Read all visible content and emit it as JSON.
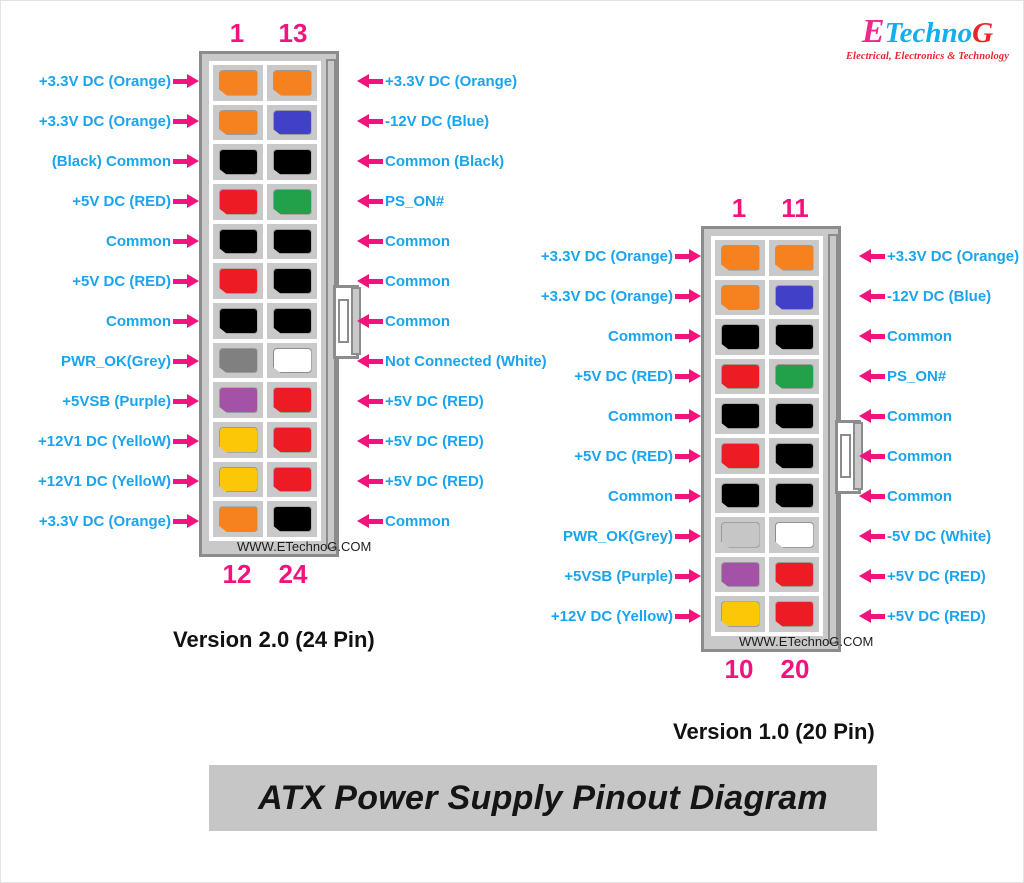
{
  "logo": {
    "letter_e": "E",
    "word_techno": "Techno",
    "letter_g": "G",
    "tagline": "Electrical, Electronics & Technology"
  },
  "banner": {
    "title": "ATX Power Supply Pinout Diagram"
  },
  "colors": {
    "label_blue": "#1ba4ee",
    "accent_pink": "#f2137e",
    "shell_grey": "#c9c9c9",
    "shell_border": "#8c8c8c",
    "banner_bg": "#c6c6c6",
    "orange": "#f5821f",
    "blue": "#4040c8",
    "black": "#000000",
    "red": "#ed1c24",
    "green": "#22a14a",
    "grey": "#808080",
    "white": "#ffffff",
    "purple": "#a452a8",
    "yellow": "#fbc707",
    "lightgrey": "#c6c6c6"
  },
  "connector24": {
    "caption": "Version 2.0 (24 Pin)",
    "watermark": "WWW.ETechnoG.COM",
    "top_left_num": "1",
    "top_right_num": "13",
    "bottom_left_num": "12",
    "bottom_right_num": "24",
    "rows": [
      {
        "left_label": "+3.3V DC (Orange)",
        "left_color": "#f5821f",
        "right_label": "+3.3V DC (Orange)",
        "right_color": "#f5821f"
      },
      {
        "left_label": "+3.3V DC (Orange)",
        "left_color": "#f5821f",
        "right_label": "-12V DC (Blue)",
        "right_color": "#4040c8"
      },
      {
        "left_label": "(Black) Common",
        "left_color": "#000000",
        "right_label": "Common (Black)",
        "right_color": "#000000"
      },
      {
        "left_label": "+5V DC (RED)",
        "left_color": "#ed1c24",
        "right_label": "PS_ON#",
        "right_color": "#22a14a"
      },
      {
        "left_label": "Common",
        "left_color": "#000000",
        "right_label": "Common",
        "right_color": "#000000"
      },
      {
        "left_label": "+5V DC (RED)",
        "left_color": "#ed1c24",
        "right_label": "Common",
        "right_color": "#000000"
      },
      {
        "left_label": "Common",
        "left_color": "#000000",
        "right_label": "Common",
        "right_color": "#000000"
      },
      {
        "left_label": "PWR_OK(Grey)",
        "left_color": "#808080",
        "right_label": "Not Connected (White)",
        "right_color": "#ffffff"
      },
      {
        "left_label": "+5VSB (Purple)",
        "left_color": "#a452a8",
        "right_label": "+5V DC (RED)",
        "right_color": "#ed1c24"
      },
      {
        "left_label": "+12V1 DC (YelloW)",
        "left_color": "#fbc707",
        "right_label": "+5V DC (RED)",
        "right_color": "#ed1c24"
      },
      {
        "left_label": "+12V1 DC (YelloW)",
        "left_color": "#fbc707",
        "right_label": "+5V DC (RED)",
        "right_color": "#ed1c24"
      },
      {
        "left_label": "+3.3V DC (Orange)",
        "left_color": "#f5821f",
        "right_label": "Common",
        "right_color": "#000000"
      }
    ]
  },
  "connector20": {
    "caption": "Version 1.0  (20 Pin)",
    "watermark": "WWW.ETechnoG.COM",
    "top_left_num": "1",
    "top_right_num": "11",
    "bottom_left_num": "10",
    "bottom_right_num": "20",
    "rows": [
      {
        "left_label": "+3.3V DC (Orange)",
        "left_color": "#f5821f",
        "right_label": "+3.3V DC (Orange)",
        "right_color": "#f5821f"
      },
      {
        "left_label": "+3.3V DC (Orange)",
        "left_color": "#f5821f",
        "right_label": "-12V DC (Blue)",
        "right_color": "#4040c8"
      },
      {
        "left_label": "Common",
        "left_color": "#000000",
        "right_label": "Common",
        "right_color": "#000000"
      },
      {
        "left_label": "+5V DC (RED)",
        "left_color": "#ed1c24",
        "right_label": "PS_ON#",
        "right_color": "#22a14a"
      },
      {
        "left_label": "Common",
        "left_color": "#000000",
        "right_label": "Common",
        "right_color": "#000000"
      },
      {
        "left_label": "+5V DC (RED)",
        "left_color": "#ed1c24",
        "right_label": "Common",
        "right_color": "#000000"
      },
      {
        "left_label": "Common",
        "left_color": "#000000",
        "right_label": "Common",
        "right_color": "#000000"
      },
      {
        "left_label": "PWR_OK(Grey)",
        "left_color": "#c6c6c6",
        "right_label": "-5V DC (White)",
        "right_color": "#ffffff"
      },
      {
        "left_label": "+5VSB (Purple)",
        "left_color": "#a452a8",
        "right_label": "+5V DC (RED)",
        "right_color": "#ed1c24"
      },
      {
        "left_label": "+12V DC (Yellow)",
        "left_color": "#fbc707",
        "right_label": "+5V DC (RED)",
        "right_color": "#ed1c24"
      }
    ]
  }
}
